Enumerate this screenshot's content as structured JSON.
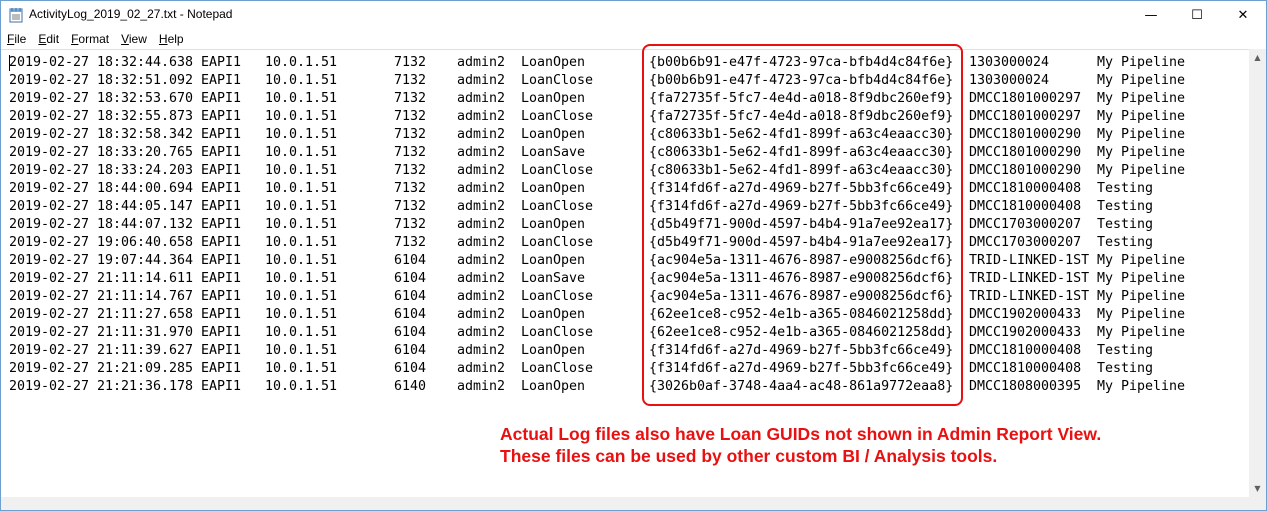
{
  "window": {
    "title": "ActivityLog_2019_02_27.txt - Notepad",
    "minimize_glyph": "—",
    "maximize_glyph": "☐",
    "close_glyph": "✕"
  },
  "menu": [
    {
      "first": "F",
      "rest": "ile"
    },
    {
      "first": "E",
      "rest": "dit"
    },
    {
      "first": "F",
      "rest": "ormat"
    },
    {
      "first": "V",
      "rest": "iew"
    },
    {
      "first": "H",
      "rest": "elp"
    }
  ],
  "log_rows": [
    {
      "date": "2019-02-27",
      "time": "18:32:44.638",
      "app": "EAPI1",
      "ip": "10.0.1.51",
      "pid": "7132",
      "user": "admin2",
      "action": "LoanOpen",
      "guid": "{b00b6b91-e47f-4723-97ca-bfb4d4c84f6e}",
      "loan": "1303000024",
      "view": "My Pipeline"
    },
    {
      "date": "2019-02-27",
      "time": "18:32:51.092",
      "app": "EAPI1",
      "ip": "10.0.1.51",
      "pid": "7132",
      "user": "admin2",
      "action": "LoanClose",
      "guid": "{b00b6b91-e47f-4723-97ca-bfb4d4c84f6e}",
      "loan": "1303000024",
      "view": "My Pipeline"
    },
    {
      "date": "2019-02-27",
      "time": "18:32:53.670",
      "app": "EAPI1",
      "ip": "10.0.1.51",
      "pid": "7132",
      "user": "admin2",
      "action": "LoanOpen",
      "guid": "{fa72735f-5fc7-4e4d-a018-8f9dbc260ef9}",
      "loan": "DMCC1801000297",
      "view": "My Pipeline"
    },
    {
      "date": "2019-02-27",
      "time": "18:32:55.873",
      "app": "EAPI1",
      "ip": "10.0.1.51",
      "pid": "7132",
      "user": "admin2",
      "action": "LoanClose",
      "guid": "{fa72735f-5fc7-4e4d-a018-8f9dbc260ef9}",
      "loan": "DMCC1801000297",
      "view": "My Pipeline"
    },
    {
      "date": "2019-02-27",
      "time": "18:32:58.342",
      "app": "EAPI1",
      "ip": "10.0.1.51",
      "pid": "7132",
      "user": "admin2",
      "action": "LoanOpen",
      "guid": "{c80633b1-5e62-4fd1-899f-a63c4eaacc30}",
      "loan": "DMCC1801000290",
      "view": "My Pipeline"
    },
    {
      "date": "2019-02-27",
      "time": "18:33:20.765",
      "app": "EAPI1",
      "ip": "10.0.1.51",
      "pid": "7132",
      "user": "admin2",
      "action": "LoanSave",
      "guid": "{c80633b1-5e62-4fd1-899f-a63c4eaacc30}",
      "loan": "DMCC1801000290",
      "view": "My Pipeline"
    },
    {
      "date": "2019-02-27",
      "time": "18:33:24.203",
      "app": "EAPI1",
      "ip": "10.0.1.51",
      "pid": "7132",
      "user": "admin2",
      "action": "LoanClose",
      "guid": "{c80633b1-5e62-4fd1-899f-a63c4eaacc30}",
      "loan": "DMCC1801000290",
      "view": "My Pipeline"
    },
    {
      "date": "2019-02-27",
      "time": "18:44:00.694",
      "app": "EAPI1",
      "ip": "10.0.1.51",
      "pid": "7132",
      "user": "admin2",
      "action": "LoanOpen",
      "guid": "{f314fd6f-a27d-4969-b27f-5bb3fc66ce49}",
      "loan": "DMCC1810000408",
      "view": "Testing"
    },
    {
      "date": "2019-02-27",
      "time": "18:44:05.147",
      "app": "EAPI1",
      "ip": "10.0.1.51",
      "pid": "7132",
      "user": "admin2",
      "action": "LoanClose",
      "guid": "{f314fd6f-a27d-4969-b27f-5bb3fc66ce49}",
      "loan": "DMCC1810000408",
      "view": "Testing"
    },
    {
      "date": "2019-02-27",
      "time": "18:44:07.132",
      "app": "EAPI1",
      "ip": "10.0.1.51",
      "pid": "7132",
      "user": "admin2",
      "action": "LoanOpen",
      "guid": "{d5b49f71-900d-4597-b4b4-91a7ee92ea17}",
      "loan": "DMCC1703000207",
      "view": "Testing"
    },
    {
      "date": "2019-02-27",
      "time": "19:06:40.658",
      "app": "EAPI1",
      "ip": "10.0.1.51",
      "pid": "7132",
      "user": "admin2",
      "action": "LoanClose",
      "guid": "{d5b49f71-900d-4597-b4b4-91a7ee92ea17}",
      "loan": "DMCC1703000207",
      "view": "Testing"
    },
    {
      "date": "2019-02-27",
      "time": "19:07:44.364",
      "app": "EAPI1",
      "ip": "10.0.1.51",
      "pid": "6104",
      "user": "admin2",
      "action": "LoanOpen",
      "guid": "{ac904e5a-1311-4676-8987-e9008256dcf6}",
      "loan": "TRID-LINKED-1ST",
      "view": "My Pipeline"
    },
    {
      "date": "2019-02-27",
      "time": "21:11:14.611",
      "app": "EAPI1",
      "ip": "10.0.1.51",
      "pid": "6104",
      "user": "admin2",
      "action": "LoanSave",
      "guid": "{ac904e5a-1311-4676-8987-e9008256dcf6}",
      "loan": "TRID-LINKED-1ST",
      "view": "My Pipeline"
    },
    {
      "date": "2019-02-27",
      "time": "21:11:14.767",
      "app": "EAPI1",
      "ip": "10.0.1.51",
      "pid": "6104",
      "user": "admin2",
      "action": "LoanClose",
      "guid": "{ac904e5a-1311-4676-8987-e9008256dcf6}",
      "loan": "TRID-LINKED-1ST",
      "view": "My Pipeline"
    },
    {
      "date": "2019-02-27",
      "time": "21:11:27.658",
      "app": "EAPI1",
      "ip": "10.0.1.51",
      "pid": "6104",
      "user": "admin2",
      "action": "LoanOpen",
      "guid": "{62ee1ce8-c952-4e1b-a365-0846021258dd}",
      "loan": "DMCC1902000433",
      "view": "My Pipeline"
    },
    {
      "date": "2019-02-27",
      "time": "21:11:31.970",
      "app": "EAPI1",
      "ip": "10.0.1.51",
      "pid": "6104",
      "user": "admin2",
      "action": "LoanClose",
      "guid": "{62ee1ce8-c952-4e1b-a365-0846021258dd}",
      "loan": "DMCC1902000433",
      "view": "My Pipeline"
    },
    {
      "date": "2019-02-27",
      "time": "21:11:39.627",
      "app": "EAPI1",
      "ip": "10.0.1.51",
      "pid": "6104",
      "user": "admin2",
      "action": "LoanOpen",
      "guid": "{f314fd6f-a27d-4969-b27f-5bb3fc66ce49}",
      "loan": "DMCC1810000408",
      "view": "Testing"
    },
    {
      "date": "2019-02-27",
      "time": "21:21:09.285",
      "app": "EAPI1",
      "ip": "10.0.1.51",
      "pid": "6104",
      "user": "admin2",
      "action": "LoanClose",
      "guid": "{f314fd6f-a27d-4969-b27f-5bb3fc66ce49}",
      "loan": "DMCC1810000408",
      "view": "Testing"
    },
    {
      "date": "2019-02-27",
      "time": "21:21:36.178",
      "app": "EAPI1",
      "ip": "10.0.1.51",
      "pid": "6140",
      "user": "admin2",
      "action": "LoanOpen",
      "guid": "{3026b0af-3748-4aa4-ac48-861a9772eaa8}",
      "loan": "DMCC1808000395",
      "view": "My Pipeline"
    }
  ],
  "annotation": {
    "line1": "Actual Log files also have Loan GUIDs not shown in Admin Report View.",
    "line2": "These files can be used by other custom BI / Analysis tools."
  },
  "colors": {
    "annotation": "#e81010",
    "window_border": "#6d9fd1"
  }
}
